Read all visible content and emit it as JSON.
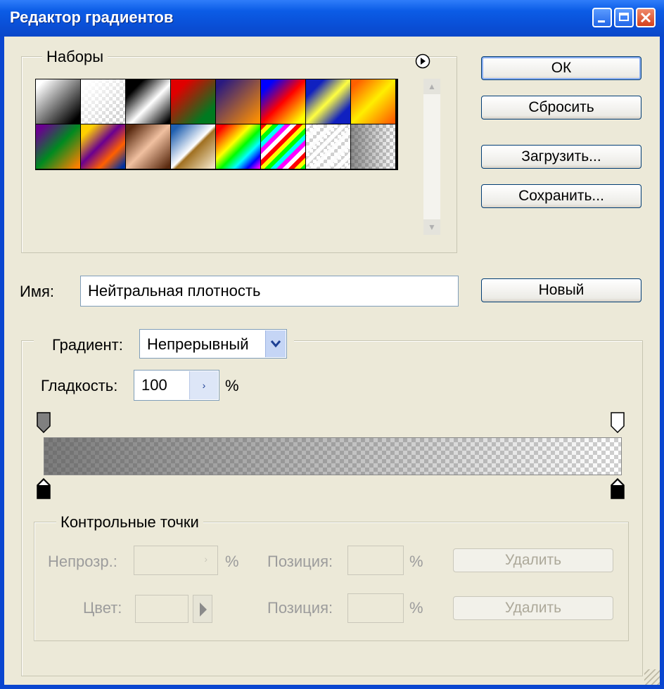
{
  "window": {
    "title": "Редактор градиентов"
  },
  "presets": {
    "legend": "Наборы",
    "menu_icon": "circle-arrow-right-icon",
    "swatches": [
      {
        "name": "black-white"
      },
      {
        "name": "transparent-white"
      },
      {
        "name": "black-white-black"
      },
      {
        "name": "red-green"
      },
      {
        "name": "violet-orange"
      },
      {
        "name": "blue-red-yellow"
      },
      {
        "name": "blue-yellow-blue"
      },
      {
        "name": "orange-yellow-orange"
      },
      {
        "name": "violet-green-orange"
      },
      {
        "name": "yellow-violet-orange-blue"
      },
      {
        "name": "copper"
      },
      {
        "name": "chrome"
      },
      {
        "name": "spectrum"
      },
      {
        "name": "transparent-rainbow"
      },
      {
        "name": "transparent-stripes"
      },
      {
        "name": "neutral-density"
      }
    ]
  },
  "buttons": {
    "ok": "ОК",
    "reset": "Сбросить",
    "load": "Загрузить...",
    "save": "Сохранить...",
    "new": "Новый"
  },
  "name_field": {
    "label": "Имя:",
    "value": "Нейтральная плотность"
  },
  "gradient_type": {
    "label": "Градиент:",
    "value": "Непрерывный"
  },
  "smoothness": {
    "label": "Гладкость:",
    "value": "100",
    "unit": "%"
  },
  "stops": {
    "legend": "Контрольные точки",
    "opacity_label": "Непрозр.:",
    "opacity_unit": "%",
    "color_label": "Цвет:",
    "position_label": "Позиция:",
    "position_unit": "%",
    "delete_label": "Удалить"
  },
  "colors": {
    "title_bar": "#0a5ce6",
    "dialog_bg": "#ece9d8",
    "default_btn_focus": "#89adf0"
  }
}
